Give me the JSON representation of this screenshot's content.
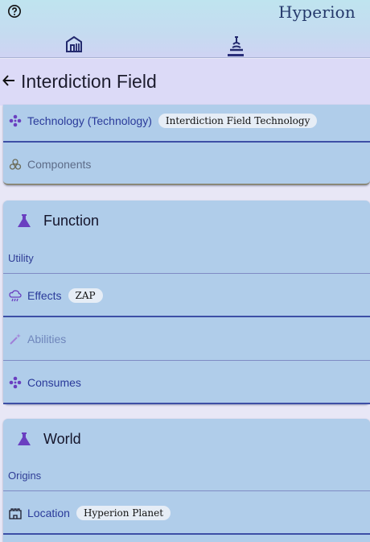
{
  "app": {
    "title": "Hyperion"
  },
  "colors": {
    "accent": "#2a3a9a",
    "icon_purple": "#6a3fc0",
    "card": "#b0cdea"
  },
  "nav": {
    "tabs": [
      {
        "icon": "home-icon"
      },
      {
        "icon": "microscope-icon",
        "active": true
      }
    ]
  },
  "header": {
    "title": "Interdiction Field"
  },
  "info": {
    "technology": {
      "label": "Technology (Technology)",
      "chip": "Interdiction Field Technology",
      "icon": "molecule-icon"
    },
    "components": {
      "label": "Components",
      "icon": "biohazard-icon"
    }
  },
  "function": {
    "title": "Function",
    "subhead": "Utility",
    "effects": {
      "label": "Effects",
      "chip": "ZAP",
      "icon": "storm-icon"
    },
    "abilities": {
      "label": "Abilities",
      "icon": "wand-icon"
    },
    "consumes": {
      "label": "Consumes",
      "icon": "molecule-icon"
    }
  },
  "world": {
    "title": "World",
    "subhead": "Origins",
    "location": {
      "label": "Location",
      "chip": "Hyperion Planet",
      "icon": "castle-icon"
    }
  }
}
